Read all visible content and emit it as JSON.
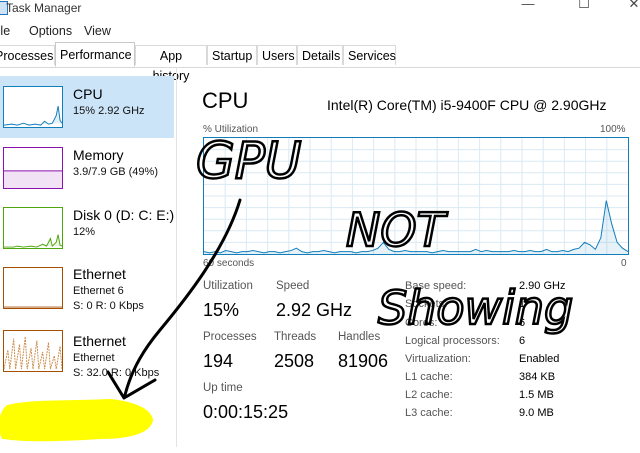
{
  "window": {
    "title": "Task Manager",
    "controls": [
      "—",
      "☐",
      "✕"
    ]
  },
  "menu": [
    "File",
    "Options",
    "View"
  ],
  "tabs": [
    "Processes",
    "Performance",
    "App history",
    "Startup",
    "Users",
    "Details",
    "Services"
  ],
  "active_tab": "Performance",
  "sidebar": {
    "items": [
      {
        "name": "CPU",
        "sub": "15% 2.92 GHz",
        "sub2": ""
      },
      {
        "name": "Memory",
        "sub": "3.9/7.9 GB (49%)",
        "sub2": ""
      },
      {
        "name": "Disk 0 (D: C: E:)",
        "sub": "12%",
        "sub2": ""
      },
      {
        "name": "Ethernet",
        "sub": "Ethernet 6",
        "sub2": "S: 0 R: 0 Kbps"
      },
      {
        "name": "Ethernet",
        "sub": "Ethernet",
        "sub2": "S: 32.0 R: 0 Kbps"
      }
    ]
  },
  "cpu": {
    "title": "CPU",
    "model": "Intel(R) Core(TM) i5-9400F CPU @ 2.90GHz",
    "graph_label": "% Utilization",
    "graph_max": "100%",
    "graph_time": "60 seconds",
    "graph_zero": "0",
    "stats": {
      "utilization_label": "Utilization",
      "utilization": "15%",
      "speed_label": "Speed",
      "speed": "2.92 GHz",
      "processes_label": "Processes",
      "processes": "194",
      "threads_label": "Threads",
      "threads": "2508",
      "handles_label": "Handles",
      "handles": "81906",
      "uptime_label": "Up time",
      "uptime": "0:00:15:25"
    },
    "specs": [
      {
        "label": "Base speed:",
        "value": "2.90 GHz"
      },
      {
        "label": "Sockets:",
        "value": "1"
      },
      {
        "label": "Cores:",
        "value": "6"
      },
      {
        "label": "Logical processors:",
        "value": "6"
      },
      {
        "label": "Virtualization:",
        "value": "Enabled"
      },
      {
        "label": "L1 cache:",
        "value": "384 KB"
      },
      {
        "label": "L2 cache:",
        "value": "1.5 MB"
      },
      {
        "label": "L3 cache:",
        "value": "9.0 MB"
      }
    ],
    "graph_values": [
      2,
      1,
      2,
      1,
      3,
      2,
      1,
      2,
      2,
      3,
      2,
      1,
      2,
      2,
      1,
      2,
      3,
      5,
      2,
      1,
      2,
      2,
      3,
      2,
      1,
      2,
      2,
      2,
      1,
      2,
      2,
      3,
      5,
      10,
      4,
      2,
      2,
      3,
      2,
      2,
      2,
      2,
      1,
      2,
      3,
      2,
      2,
      2,
      2,
      2,
      4,
      2,
      3,
      2,
      2,
      2,
      2,
      3,
      2,
      2,
      3,
      2,
      2,
      4,
      2,
      2,
      3,
      2,
      4,
      5,
      10,
      8,
      4,
      14,
      46,
      26,
      10,
      5,
      2
    ]
  },
  "annotations": {
    "text1": "GPU",
    "text2": "NOT",
    "text3": "Showing",
    "highlight_color": "#ffff00",
    "ink_color": "#000000"
  }
}
